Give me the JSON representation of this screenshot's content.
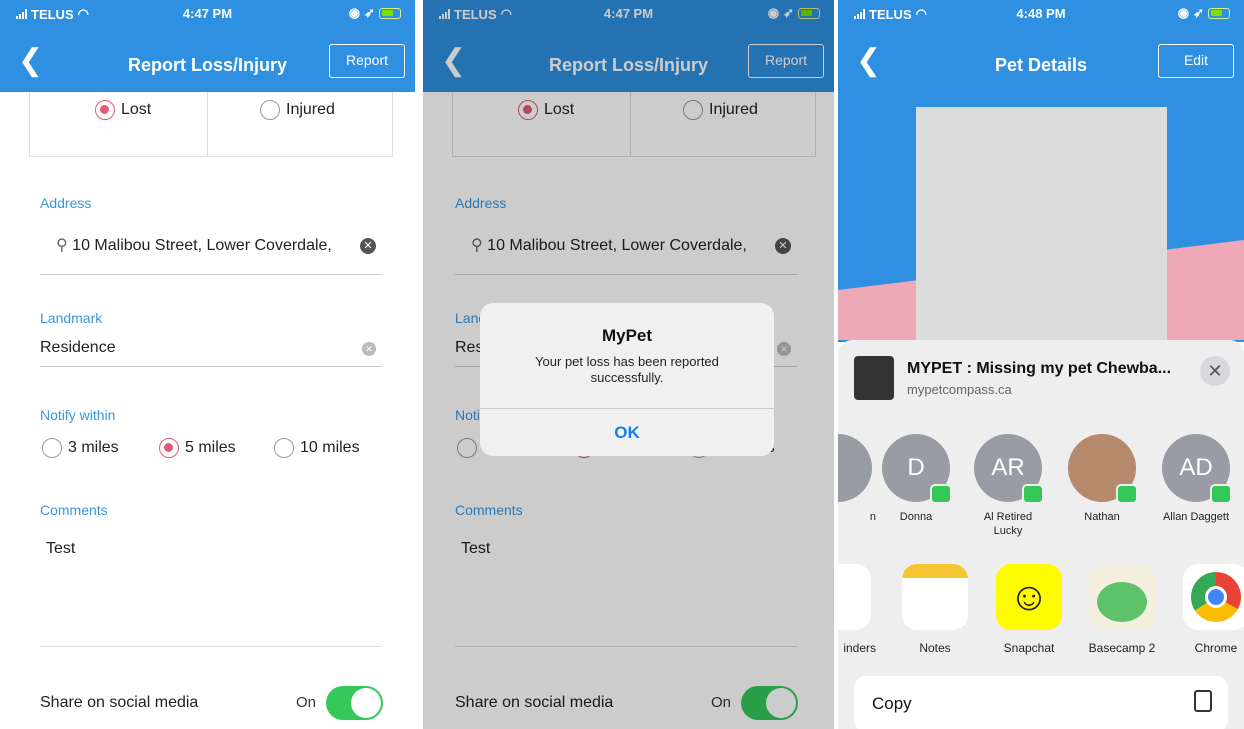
{
  "status_bar": {
    "carrier": "TELUS",
    "time_1": "4:47 PM",
    "time_2": "4:47 PM",
    "time_3": "4:48 PM"
  },
  "report_screen": {
    "back_icon": "chevron-left-icon",
    "title": "Report Loss/Injury",
    "report_button": "Report",
    "type_options": [
      {
        "label": "Lost",
        "selected": true
      },
      {
        "label": "Injured",
        "selected": false
      }
    ],
    "address_label": "Address",
    "address_value": "10 Malibou Street, Lower Coverdale,",
    "landmark_label": "Landmark",
    "landmark_value": "Residence",
    "notify_label": "Notify within",
    "notify_options": [
      {
        "label": "3 miles",
        "selected": false
      },
      {
        "label": "5 miles",
        "selected": true
      },
      {
        "label": "10 miles",
        "selected": false
      }
    ],
    "comments_label": "Comments",
    "comments_value": "Test",
    "share_label": "Share on social media",
    "share_state": "On"
  },
  "alert": {
    "title": "MyPet",
    "message": "Your pet loss has been reported successfully.",
    "ok": "OK"
  },
  "pet_details": {
    "title": "Pet Details",
    "edit_button": "Edit",
    "share_sheet": {
      "title": "MYPET : Missing my pet Chewba...",
      "url": "mypetcompass.ca",
      "contacts": [
        {
          "initials": "",
          "name": "n"
        },
        {
          "initials": "D",
          "name": "Donna"
        },
        {
          "initials": "AR",
          "name": "Al Retired Lucky"
        },
        {
          "initials": "",
          "name": "Nathan"
        },
        {
          "initials": "AD",
          "name": "Allan Daggett"
        }
      ],
      "apps": [
        "inders",
        "Notes",
        "Snapchat",
        "Basecamp 2",
        "Chrome"
      ],
      "copy_label": "Copy"
    }
  },
  "colors": {
    "header": "#2f8fe0",
    "accent": "#e45a76",
    "toggle": "#34c759",
    "link": "#1a7fe8"
  }
}
